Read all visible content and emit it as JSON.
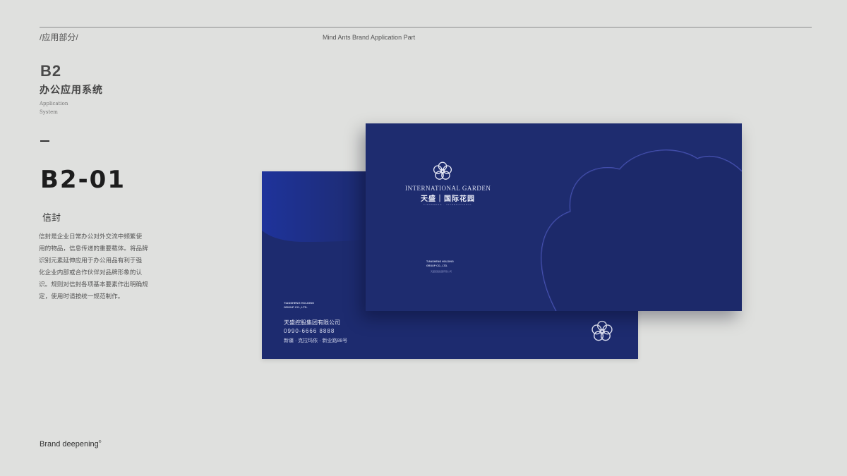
{
  "header": {
    "section_label": "/应用部分/",
    "caption": "Mind Ants Brand  Application Part"
  },
  "sidebar": {
    "code": "B2",
    "system_zh": "办公应用系统",
    "system_en": "Application\nSystem",
    "item_code": "B2-01",
    "item_title": "信封",
    "description_lines": [
      "信封是企业日常办公对外交流中频繁使",
      "用的物品，信息传递的重要载体。将品牌",
      "识别元素延伸应用于办公用品有利于强",
      "化企业内部或合作伙伴对品牌形象的认",
      "识。规则对信封各项基本要素作出明确规",
      "定，使用时请按统一规范制作。"
    ]
  },
  "footer": {
    "brand": "Brand deepening",
    "brand_mark": "®"
  },
  "envelope_back": {
    "company_en": "TIANSHENG HOLDING\nGROUP CO., LTD.",
    "company_zh": "天盛控股集团有限公司",
    "phone": "0990-6666 8888",
    "address": "新疆 · 克拉玛依 · 新业路88号",
    "logo_icon": "flower-knot-icon"
  },
  "envelope_front": {
    "logo_icon": "flower-knot-icon",
    "brand_en": "INTERNATIONAL GARDEN",
    "brand_zh": "天盛｜国际花园",
    "brand_sub": "TIANSHENG · INTERNATIONAL",
    "company_en": "TIANSHENG HOLDING\nGROUP CO., LTD.",
    "company_small": "天盛控股集团有限公司"
  },
  "colors": {
    "background": "#dfe0de",
    "envelope_navy": "#1e2c6f",
    "accent_line": "#4a55b8"
  }
}
